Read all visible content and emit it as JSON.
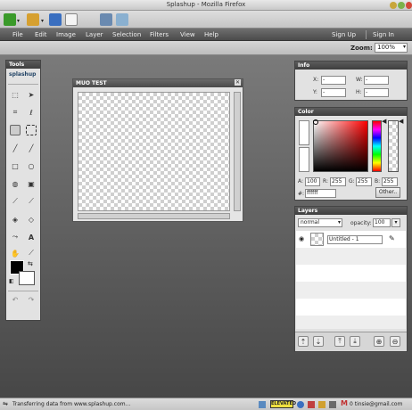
{
  "window": {
    "title": "Splashup - Mozilla Firefox"
  },
  "menu": [
    "File",
    "Edit",
    "Image",
    "Layer",
    "Selection",
    "Filters",
    "View",
    "Help"
  ],
  "auth": {
    "sign_up": "Sign Up",
    "sign_in": "Sign In"
  },
  "zoom": {
    "label": "Zoom:",
    "value": "100%"
  },
  "tools": {
    "title": "Tools",
    "logo": "splashup"
  },
  "canvas": {
    "title": "MUO TEST"
  },
  "info": {
    "title": "Info",
    "x_label": "X:",
    "y_label": "Y:",
    "w_label": "W:",
    "h_label": "H:",
    "x": "-",
    "y": "-",
    "w": "-",
    "h": "-"
  },
  "color": {
    "title": "Color",
    "a_label": "A:",
    "a": "100",
    "r_label": "R:",
    "r": "255",
    "g_label": "G:",
    "g": "255",
    "b_label": "B:",
    "b": "255",
    "hex_label": "#:",
    "hex": "ffffff",
    "other": "Other..",
    "hue_color": "#ff0000"
  },
  "layers": {
    "title": "Layers",
    "mode": "normal",
    "opacity_label": "opacity:",
    "opacity": "100",
    "layer_name": "Untitled - 1"
  },
  "status": {
    "text": "Transferring data from www.splashup.com...",
    "elevated": "ELEVATED",
    "email": "0 tinsie@gmail.com"
  },
  "colors": {
    "menubar": "#4b4b4b",
    "panel_header": "#3e3e3e",
    "brand_green": "#3a9a2a"
  }
}
